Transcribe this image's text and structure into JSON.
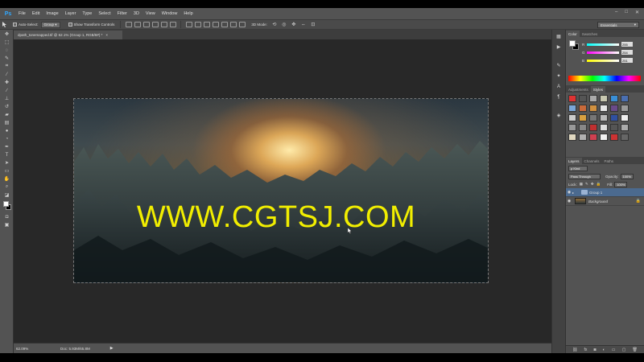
{
  "menu": {
    "logo": "Ps",
    "items": [
      "File",
      "Edit",
      "Image",
      "Layer",
      "Type",
      "Select",
      "Filter",
      "3D",
      "View",
      "Window",
      "Help"
    ]
  },
  "window_controls": [
    "–",
    "□",
    "✕"
  ],
  "options": {
    "auto_select_label": "Auto-Select:",
    "auto_select_value": "Group",
    "transform_label": "Show Transform Controls",
    "mode_label": "3D Mode:",
    "workspace": "Essentials"
  },
  "document": {
    "tab_title": "dpath_tonemapped.tif @ 62.1% (Group 1, RGB/8#) *",
    "tab_close": "×",
    "watermark": "WWW.CGTSJ.COM",
    "zoom": "62.09%",
    "doc_info": "Doc: 5.93M/65.8M",
    "status_arrow": "▶"
  },
  "panels": {
    "color_tabs": [
      "Color",
      "Swatches"
    ],
    "sliders": [
      {
        "label": "R",
        "value": "255"
      },
      {
        "label": "G",
        "value": "254"
      },
      {
        "label": "B",
        "value": "251"
      }
    ],
    "adjust_tabs": [
      "Adjustments",
      "Styles"
    ],
    "style_swatches": [
      "#d33",
      "#555",
      "#aaa",
      "#c8c8b0",
      "#3a8fd6",
      "#4a6fb0",
      "#7aa6d8",
      "#c86a3a",
      "#d09040",
      "#e8e8e8",
      "#6a4a8a",
      "#9a9a9a",
      "#cccccc",
      "#d8a040",
      "#777777",
      "#bbbbbb",
      "#3050a0",
      "#eeeeee",
      "#999999",
      "#888888",
      "#c03030",
      "#dddddd",
      "#555555",
      "#aaaaaa",
      "#e0d8c0",
      "#b0b0b0",
      "#d04050",
      "#f0f0f0",
      "#cc3333",
      "#666666"
    ],
    "layer_tabs": [
      "Layers",
      "Channels",
      "Paths"
    ],
    "kind_label": "ρ Kind",
    "blend_mode": "Pass Through",
    "opacity_label": "Opacity:",
    "opacity_value": "100%",
    "lock_label": "Lock:",
    "fill_label": "Fill:",
    "fill_value": "100%",
    "layers": [
      {
        "name": "Group 1",
        "type": "group",
        "selected": true
      },
      {
        "name": "Background",
        "type": "image",
        "selected": false
      }
    ],
    "footer_icons": [
      "⛓",
      "fx",
      "◙",
      "◐",
      "▭",
      "▢",
      "🗑"
    ]
  },
  "colors": {
    "watermark": "#f1ee00",
    "selection": "#4b6a8f",
    "ps_blue": "#31a8ff"
  }
}
